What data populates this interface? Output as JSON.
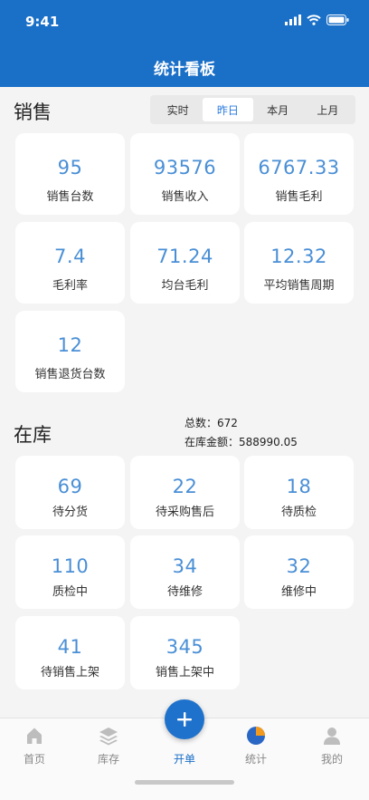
{
  "status": {
    "time": "9:41"
  },
  "header": {
    "title": "统计看板"
  },
  "sales": {
    "title": "销售",
    "tabs": [
      {
        "label": "实时",
        "active": false
      },
      {
        "label": "昨日",
        "active": true
      },
      {
        "label": "本月",
        "active": false
      },
      {
        "label": "上月",
        "active": false
      }
    ],
    "cards": [
      {
        "value": "95",
        "label": "销售台数"
      },
      {
        "value": "93576",
        "label": "销售收入"
      },
      {
        "value": "6767.33",
        "label": "销售毛利"
      },
      {
        "value": "7.4",
        "label": "毛利率"
      },
      {
        "value": "71.24",
        "label": "均台毛利"
      },
      {
        "value": "12.32",
        "label": "平均销售周期"
      },
      {
        "value": "12",
        "label": "销售退货台数"
      }
    ]
  },
  "inventory": {
    "title": "在库",
    "total_count_label": "总数：672",
    "total_amount_label": "在库金额：588990.05",
    "cards": [
      {
        "value": "69",
        "label": "待分货"
      },
      {
        "value": "22",
        "label": "待采购售后"
      },
      {
        "value": "18",
        "label": "待质检"
      },
      {
        "value": "110",
        "label": "质检中"
      },
      {
        "value": "34",
        "label": "待维修"
      },
      {
        "value": "32",
        "label": "维修中"
      },
      {
        "value": "41",
        "label": "待销售上架"
      },
      {
        "value": "345",
        "label": "销售上架中"
      }
    ]
  },
  "tabbar": {
    "fab_icon": "plus-icon",
    "items": [
      {
        "label": "首页",
        "icon": "home-icon",
        "active": false
      },
      {
        "label": "库存",
        "icon": "layers-icon",
        "active": false
      },
      {
        "label": "开单",
        "icon": "plus-icon",
        "active": true
      },
      {
        "label": "统计",
        "icon": "pie-chart-icon",
        "active": false
      },
      {
        "label": "我的",
        "icon": "user-icon",
        "active": false
      }
    ]
  },
  "colors": {
    "primary": "#1a6fc7",
    "value_text": "#4a8fd6",
    "background": "#f4f4f4"
  }
}
